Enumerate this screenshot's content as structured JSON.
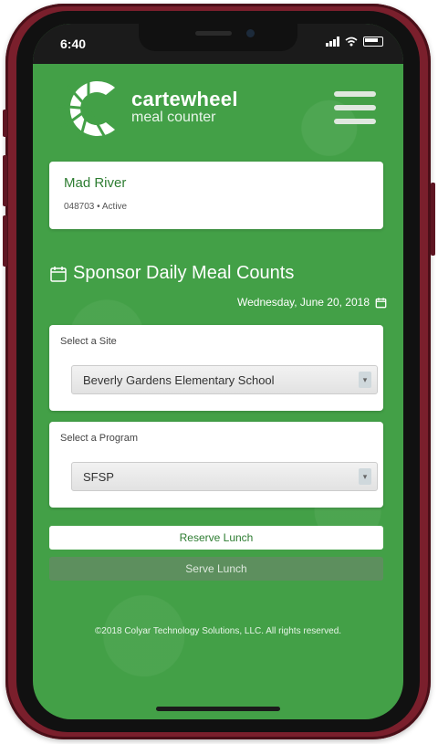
{
  "status_bar": {
    "time": "6:40"
  },
  "brand": {
    "name": "cartewheel",
    "subtitle": "meal counter"
  },
  "sponsor": {
    "name": "Mad River",
    "meta": "048703 • Active"
  },
  "section": {
    "title": "Sponsor Daily Meal Counts",
    "date": "Wednesday, June 20, 2018"
  },
  "site_select": {
    "label": "Select a Site",
    "value": "Beverly Gardens Elementary School"
  },
  "program_select": {
    "label": "Select a Program",
    "value": "SFSP"
  },
  "actions": {
    "reserve_label": "Reserve Lunch",
    "serve_label": "Serve Lunch"
  },
  "footer": {
    "copyright": "©2018 Colyar Technology Solutions, LLC. All rights reserved."
  },
  "colors": {
    "brand_green": "#43a047",
    "frame": "#7a1f2c",
    "text_green": "#2e7d32"
  },
  "icons": {
    "menu": "hamburger-icon",
    "calendar": "calendar-icon",
    "date_picker": "calendar-icon",
    "logo": "cartewheel-logo"
  }
}
